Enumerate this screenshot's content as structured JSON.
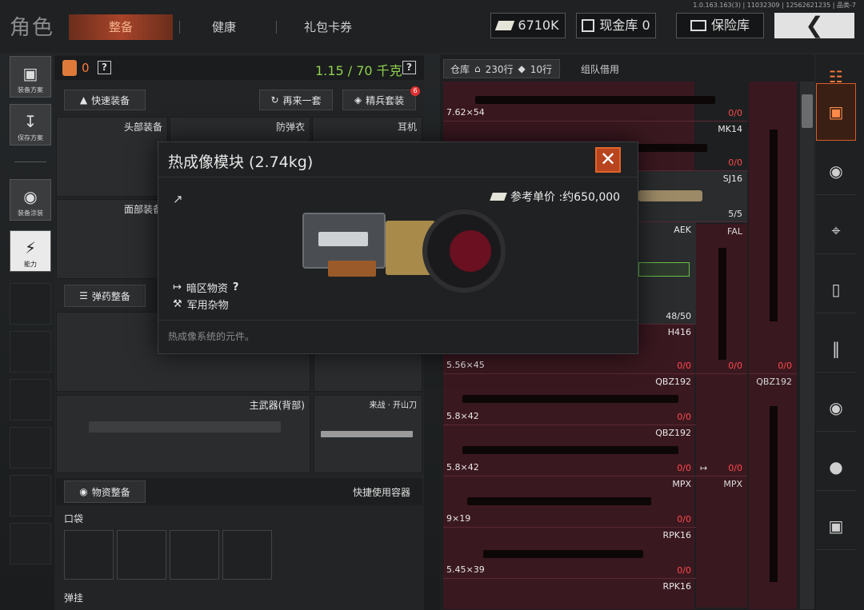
{
  "header": {
    "page_title": "角色",
    "tabs": [
      {
        "label": "整备"
      },
      {
        "label": "健康"
      },
      {
        "label": "礼包卡券"
      }
    ],
    "version": "1.0.163.163(3) | 11032309 | 12562621235 | 品类-7",
    "currency": "6710K",
    "cash_vault": "现金库 0",
    "safe_box": "保险库"
  },
  "left_rail": {
    "items": [
      {
        "label": "装备方案"
      },
      {
        "label": "保存方案"
      },
      {
        "label": "装备涂装"
      },
      {
        "label": "能力"
      }
    ]
  },
  "loadout": {
    "armor_count": "0",
    "help": "?",
    "weight": "1.15 / 70 千克",
    "quick_equip": "快速装备",
    "again_set": "再来一套",
    "elite_set": "精兵套装",
    "elite_badge": "6",
    "slots": {
      "head": "头部装备",
      "armor": "防弹衣",
      "earphone": "耳机",
      "face": "面部装备",
      "primary_back": "主武器(背部)",
      "melee": "来战 · 开山刀"
    },
    "ammo_btn": "弹药整备",
    "supplies_btn": "物资整备",
    "quick_container": "快捷使用容器",
    "pocket": "口袋",
    "hang": "弹挂"
  },
  "warehouse": {
    "tab_label": "仓库",
    "rows_label": "230行",
    "tag_label": "10行",
    "team_borrow": "组队借用",
    "rows": [
      {
        "name": "",
        "caliber": "7.62×54",
        "count": "0/0"
      },
      {
        "name": "MK14",
        "caliber": "",
        "count": "0/0"
      },
      {
        "name": "SJ16",
        "caliber": "",
        "count": "5/5"
      },
      {
        "name": "AEK",
        "caliber": "",
        "count": "48/50"
      },
      {
        "name": "H416",
        "caliber": "5.56×45",
        "count": "0/0"
      },
      {
        "name": "QBZ192",
        "caliber": "5.8×42",
        "count": "0/0"
      },
      {
        "name": "QBZ192",
        "caliber": "5.8×42",
        "count": "0/0"
      },
      {
        "name": "MPX",
        "caliber": "9×19",
        "count": "0/0"
      },
      {
        "name": "RPK16",
        "caliber": "5.45×39",
        "count": "0/0"
      },
      {
        "name": "RPK16",
        "caliber": "",
        "count": ""
      }
    ],
    "side_col": [
      {
        "name": "FAL",
        "count": "0/0"
      },
      {
        "name": "",
        "count": "0/0"
      },
      {
        "name": "MPX",
        "count": ""
      }
    ],
    "far_col": [
      {
        "name": "QBZ192",
        "count": "0/0"
      }
    ]
  },
  "modal": {
    "title": "热成像模块 (2.74kg)",
    "ref_price": "参考单价 :约650,000",
    "category1": "暗区物资",
    "category1_help": "?",
    "category2": "军用杂物",
    "description": "热成像系统的元件。",
    "close": "✕"
  },
  "colors": {
    "accent": "#d45a2a",
    "weight_green": "#8fd14f",
    "danger": "#ff4a4a"
  }
}
